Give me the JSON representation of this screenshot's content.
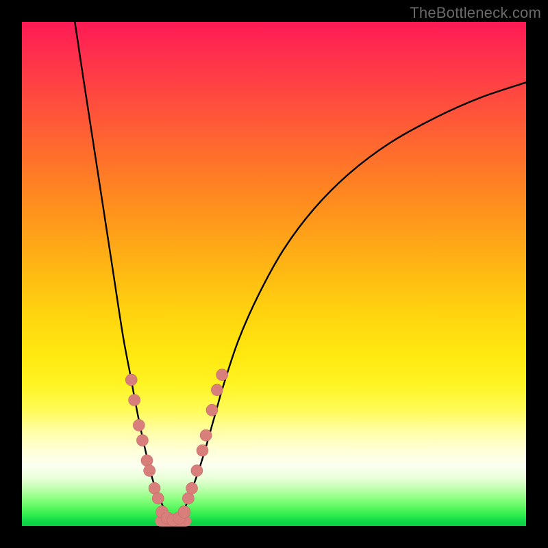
{
  "watermark": "TheBottleneck.com",
  "colors": {
    "curve_stroke": "#000000",
    "bead_fill": "#d87f7c",
    "bead_stroke": "#c46a67"
  },
  "chart_data": {
    "type": "line",
    "title": "",
    "xlabel": "",
    "ylabel": "",
    "xlim": [
      0,
      100
    ],
    "ylim": [
      0,
      100
    ],
    "grid": false,
    "legend": false,
    "series": [
      {
        "name": "left-branch",
        "x": [
          10.5,
          12,
          14,
          16,
          18,
          20,
          21.5,
          23,
          24.5,
          26,
          27.5,
          29,
          30
        ],
        "y": [
          100,
          90,
          77,
          64,
          51,
          38,
          30,
          22,
          15,
          9,
          5,
          2,
          1
        ]
      },
      {
        "name": "right-branch",
        "x": [
          30,
          32,
          34,
          36,
          38,
          40,
          43,
          47,
          52,
          58,
          65,
          73,
          82,
          91,
          100
        ],
        "y": [
          1,
          3,
          8,
          14,
          21,
          28,
          37,
          46,
          55,
          63,
          70,
          76,
          81,
          85,
          88
        ]
      }
    ],
    "valley_flat": {
      "x_start": 27.5,
      "x_end": 32.5,
      "y": 1
    },
    "beads_left_branch": [
      {
        "x": 21.7,
        "y": 29
      },
      {
        "x": 22.3,
        "y": 25
      },
      {
        "x": 23.2,
        "y": 20
      },
      {
        "x": 23.9,
        "y": 17
      },
      {
        "x": 24.8,
        "y": 13
      },
      {
        "x": 25.3,
        "y": 11
      },
      {
        "x": 26.3,
        "y": 7.5
      },
      {
        "x": 27.0,
        "y": 5.5
      }
    ],
    "beads_right_branch": [
      {
        "x": 33.0,
        "y": 5.5
      },
      {
        "x": 33.7,
        "y": 7.5
      },
      {
        "x": 34.7,
        "y": 11
      },
      {
        "x": 35.8,
        "y": 15
      },
      {
        "x": 36.5,
        "y": 18
      },
      {
        "x": 37.7,
        "y": 23
      },
      {
        "x": 38.7,
        "y": 27
      },
      {
        "x": 39.7,
        "y": 30
      }
    ],
    "beads_bottom": [
      {
        "x": 27.8,
        "y": 2.8
      },
      {
        "x": 28.8,
        "y": 1.6
      },
      {
        "x": 30.0,
        "y": 1.2
      },
      {
        "x": 31.2,
        "y": 1.6
      },
      {
        "x": 32.2,
        "y": 2.8
      }
    ]
  }
}
